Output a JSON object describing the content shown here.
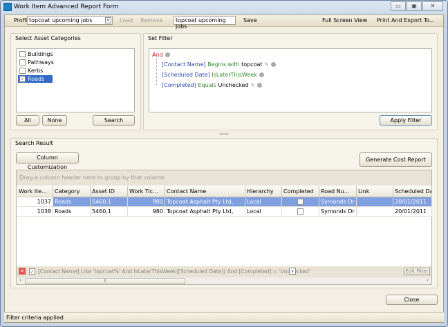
{
  "window": {
    "title": "Work Item Advanced Report Form",
    "min": "▭",
    "max": "▣",
    "close": "✕"
  },
  "toolbar": {
    "profile_label": "Profile",
    "profile_value": "topcoat upcoming jobs",
    "load": "Load",
    "remove": "Remove",
    "name_value": "topcoat upcoming jobs",
    "save": "Save",
    "full_screen": "Full Screen View",
    "print_export": "Print And Export To..."
  },
  "categories": {
    "title": "Select Asset Categories",
    "items": [
      {
        "label": "Buildings",
        "checked": false
      },
      {
        "label": "Pathways",
        "checked": false
      },
      {
        "label": "Kerbs",
        "checked": false
      },
      {
        "label": "Roads",
        "checked": true
      }
    ],
    "all": "All",
    "none": "None",
    "search": "Search"
  },
  "filter": {
    "title": "Set Filter",
    "root": "And",
    "conditions": [
      {
        "field": "[Contact Name]",
        "op": "Begins with",
        "value": "topcoat"
      },
      {
        "field": "[Scheduled Date]",
        "op": "IsLaterThisWeek",
        "value": ""
      },
      {
        "field": "[Completed]",
        "op": "Equals",
        "value": "Unchecked"
      }
    ],
    "apply": "Apply Filter"
  },
  "results": {
    "title": "Search Result",
    "column_customization": "Column Customization",
    "generate": "Generate Cost Report",
    "group_hint": "Drag a column header here to group by that column",
    "columns": [
      "Work Ite...",
      "Category",
      "Asset ID",
      "Work Tic...",
      "Contact Name",
      "Hierarchy",
      "Completed",
      "Road Nu...",
      "Link",
      "Scheduled Date"
    ],
    "rows": [
      {
        "work_item": "1037",
        "category": "Roads",
        "asset_id": "5460,1",
        "work_ticket": "980",
        "contact": "Topcoat Asphalt Pty Ltd,",
        "hierarchy": "Local",
        "completed": false,
        "road": "Symonds Dr",
        "link": "",
        "date": "20/01/2011",
        "selected": true
      },
      {
        "work_item": "1038",
        "category": "Roads",
        "asset_id": "5460,1",
        "work_ticket": "980",
        "contact": "Topcoat Asphalt Pty Ltd,",
        "hierarchy": "Local",
        "completed": false,
        "road": "Symonds Dr",
        "link": "",
        "date": "20/01/2011",
        "selected": false
      }
    ],
    "filter_text": "[Contact Name] Like 'topcoat%' And IsLaterThisWeek([Scheduled Date]) And [Completed] = 'Unchecked'",
    "edit_filter": "Edit Filter"
  },
  "close": "Close",
  "status": "Filter criteria applied"
}
